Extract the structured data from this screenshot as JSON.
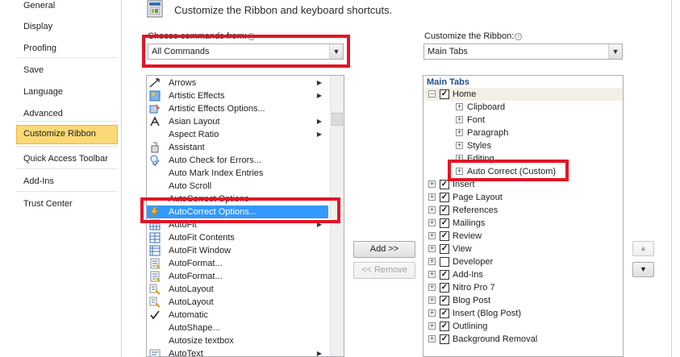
{
  "nav": {
    "items": [
      {
        "label": "General",
        "selected": false
      },
      {
        "label": "Display",
        "selected": false
      },
      {
        "label": "Proofing",
        "selected": false
      },
      {
        "label": "Save",
        "selected": false
      },
      {
        "label": "Language",
        "selected": false
      },
      {
        "label": "Advanced",
        "selected": false
      },
      {
        "label": "Customize Ribbon",
        "selected": true
      },
      {
        "label": "Quick Access Toolbar",
        "selected": false
      },
      {
        "label": "Add-Ins",
        "selected": false
      },
      {
        "label": "Trust Center",
        "selected": false
      }
    ]
  },
  "header": {
    "title": "Customize the Ribbon and keyboard shortcuts.",
    "icon": "customize-ribbon-icon"
  },
  "commands_panel": {
    "label": "Choose commands from:",
    "selected_value": "All Commands",
    "items": [
      {
        "label": "Arrows",
        "icon": "arrows-icon",
        "submenu": true
      },
      {
        "label": "Artistic Effects",
        "icon": "artistic-effects-icon",
        "submenu": true
      },
      {
        "label": "Artistic Effects Options...",
        "icon": "artistic-effects-options-icon",
        "submenu": false
      },
      {
        "label": "Asian Layout",
        "icon": "asian-layout-icon",
        "submenu": true
      },
      {
        "label": "Aspect Ratio",
        "icon": "",
        "submenu": true
      },
      {
        "label": "Assistant",
        "icon": "assistant-icon",
        "submenu": false
      },
      {
        "label": "Auto Check for Errors...",
        "icon": "auto-check-icon",
        "submenu": false
      },
      {
        "label": "Auto Mark Index Entries",
        "icon": "",
        "submenu": false
      },
      {
        "label": "Auto Scroll",
        "icon": "",
        "submenu": false
      },
      {
        "label": "AutoCorrect Options",
        "icon": "",
        "submenu": false
      },
      {
        "label": "AutoCorrect Options...",
        "icon": "autocorrect-icon",
        "submenu": false,
        "selected": true
      },
      {
        "label": "AutoFit",
        "icon": "autofit-icon",
        "submenu": true
      },
      {
        "label": "AutoFit Contents",
        "icon": "autofit-contents-icon",
        "submenu": false
      },
      {
        "label": "AutoFit Window",
        "icon": "autofit-window-icon",
        "submenu": false
      },
      {
        "label": "AutoFormat...",
        "icon": "autoformat-icon",
        "submenu": false
      },
      {
        "label": "AutoFormat...",
        "icon": "autoformat-icon",
        "submenu": false
      },
      {
        "label": "AutoLayout",
        "icon": "autolayout-icon",
        "submenu": false
      },
      {
        "label": "AutoLayout",
        "icon": "autolayout-icon",
        "submenu": false
      },
      {
        "label": "Automatic",
        "icon": "checkmark-icon",
        "submenu": false
      },
      {
        "label": "AutoShape...",
        "icon": "",
        "submenu": false
      },
      {
        "label": "Autosize textbox",
        "icon": "",
        "submenu": false
      },
      {
        "label": "AutoText",
        "icon": "autotext-icon",
        "submenu": true
      }
    ]
  },
  "buttons": {
    "add": "Add >>",
    "remove": "<< Remove"
  },
  "ribbon_panel": {
    "label": "Customize the Ribbon:",
    "selected_value": "Main Tabs",
    "header": "Main Tabs",
    "tree": [
      {
        "label": "Home",
        "level": 0,
        "expander": "−",
        "checked": true,
        "highlight": true
      },
      {
        "label": "Clipboard",
        "level": 1,
        "expander": "+"
      },
      {
        "label": "Font",
        "level": 1,
        "expander": "+"
      },
      {
        "label": "Paragraph",
        "level": 1,
        "expander": "+"
      },
      {
        "label": "Styles",
        "level": 1,
        "expander": "+"
      },
      {
        "label": "Editing",
        "level": 1,
        "expander": "+"
      },
      {
        "label": "Auto Correct (Custom)",
        "level": 1,
        "expander": "+"
      },
      {
        "label": "Insert",
        "level": 0,
        "expander": "+",
        "checked": true
      },
      {
        "label": "Page Layout",
        "level": 0,
        "expander": "+",
        "checked": true
      },
      {
        "label": "References",
        "level": 0,
        "expander": "+",
        "checked": true
      },
      {
        "label": "Mailings",
        "level": 0,
        "expander": "+",
        "checked": true
      },
      {
        "label": "Review",
        "level": 0,
        "expander": "+",
        "checked": true
      },
      {
        "label": "View",
        "level": 0,
        "expander": "+",
        "checked": true
      },
      {
        "label": "Developer",
        "level": 0,
        "expander": "+",
        "checked": false
      },
      {
        "label": "Add-Ins",
        "level": 0,
        "expander": "+",
        "checked": true
      },
      {
        "label": "Nitro Pro 7",
        "level": 0,
        "expander": "+",
        "checked": true
      },
      {
        "label": "Blog Post",
        "level": 0,
        "expander": "+",
        "checked": true
      },
      {
        "label": "Insert (Blog Post)",
        "level": 0,
        "expander": "+",
        "checked": true
      },
      {
        "label": "Outlining",
        "level": 0,
        "expander": "+",
        "checked": true
      },
      {
        "label": "Background Removal",
        "level": 0,
        "expander": "+",
        "checked": true
      }
    ]
  },
  "move_buttons": {
    "up": "▲",
    "down": "▼"
  },
  "colors": {
    "highlight_box": "#e11525",
    "selection": "#3399ff",
    "nav_selected": "#fcd976"
  }
}
